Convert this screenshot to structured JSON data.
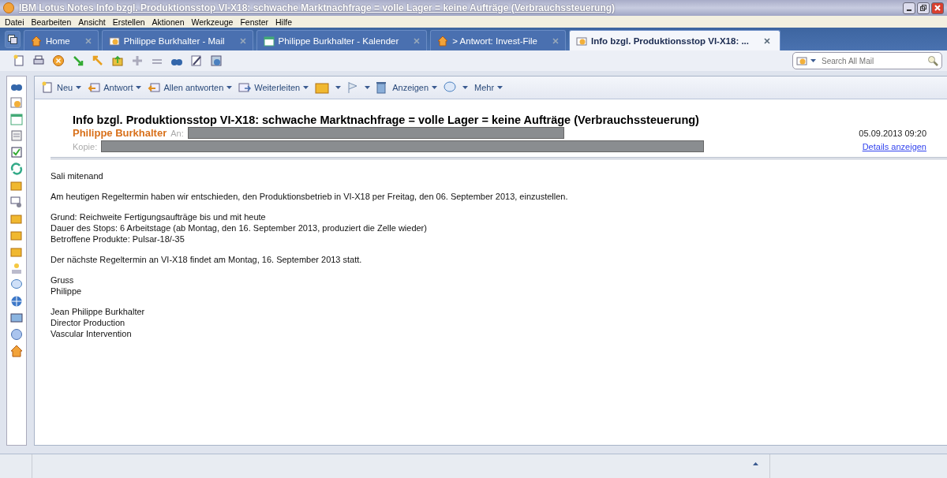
{
  "window": {
    "title": "IBM Lotus Notes Info bzgl. Produktionsstop VI-X18: schwache Marktnachfrage = volle Lager = keine Aufträge (Verbrauchssteuerung)"
  },
  "menu": [
    "Datei",
    "Bearbeiten",
    "Ansicht",
    "Erstellen",
    "Aktionen",
    "Werkzeuge",
    "Fenster",
    "Hilfe"
  ],
  "tabs": [
    {
      "label": "Home",
      "selected": false
    },
    {
      "label": "Philippe Burkhalter - Mail",
      "selected": false
    },
    {
      "label": "Philippe Burkhalter - Kalender",
      "selected": false
    },
    {
      "label": "> Antwort: Invest-File",
      "selected": false
    },
    {
      "label": "Info bzgl. Produktionsstop VI-X18: ...",
      "selected": true
    }
  ],
  "search": {
    "placeholder": "Search All Mail"
  },
  "actions": [
    "Neu",
    "Antwort",
    "Allen antworten",
    "Weiterleiten",
    "Anzeigen",
    "Mehr"
  ],
  "message": {
    "subject": "Info bzgl. Produktionsstop VI-X18: schwache Marktnachfrage = volle Lager = keine Aufträge (Verbrauchssteuerung)",
    "sender": "Philippe Burkhalter",
    "to_label": "An:",
    "cc_label": "Kopie:",
    "date": "05.09.2013 09:20",
    "details_link": "Details anzeigen",
    "body": [
      [
        "Sali mitenand"
      ],
      [
        "Am heutigen Regeltermin haben wir entschieden, den Produktionsbetrieb in VI-X18 per Freitag, den 06. September 2013, einzustellen."
      ],
      [
        "Grund: Reichweite Fertigungsaufträge bis und mit heute",
        "Dauer des Stops: 6 Arbeitstage (ab Montag, den 16. September 2013, produziert die Zelle wieder)",
        "Betroffene Produkte: Pulsar-18/-35"
      ],
      [
        "Der nächste Regeltermin an VI-X18 findet am Montag, 16. September 2013 statt."
      ],
      [
        "Gruss",
        "Philippe"
      ],
      [
        "Jean Philippe Burkhalter",
        "Director Production",
        "Vascular Intervention"
      ]
    ]
  }
}
